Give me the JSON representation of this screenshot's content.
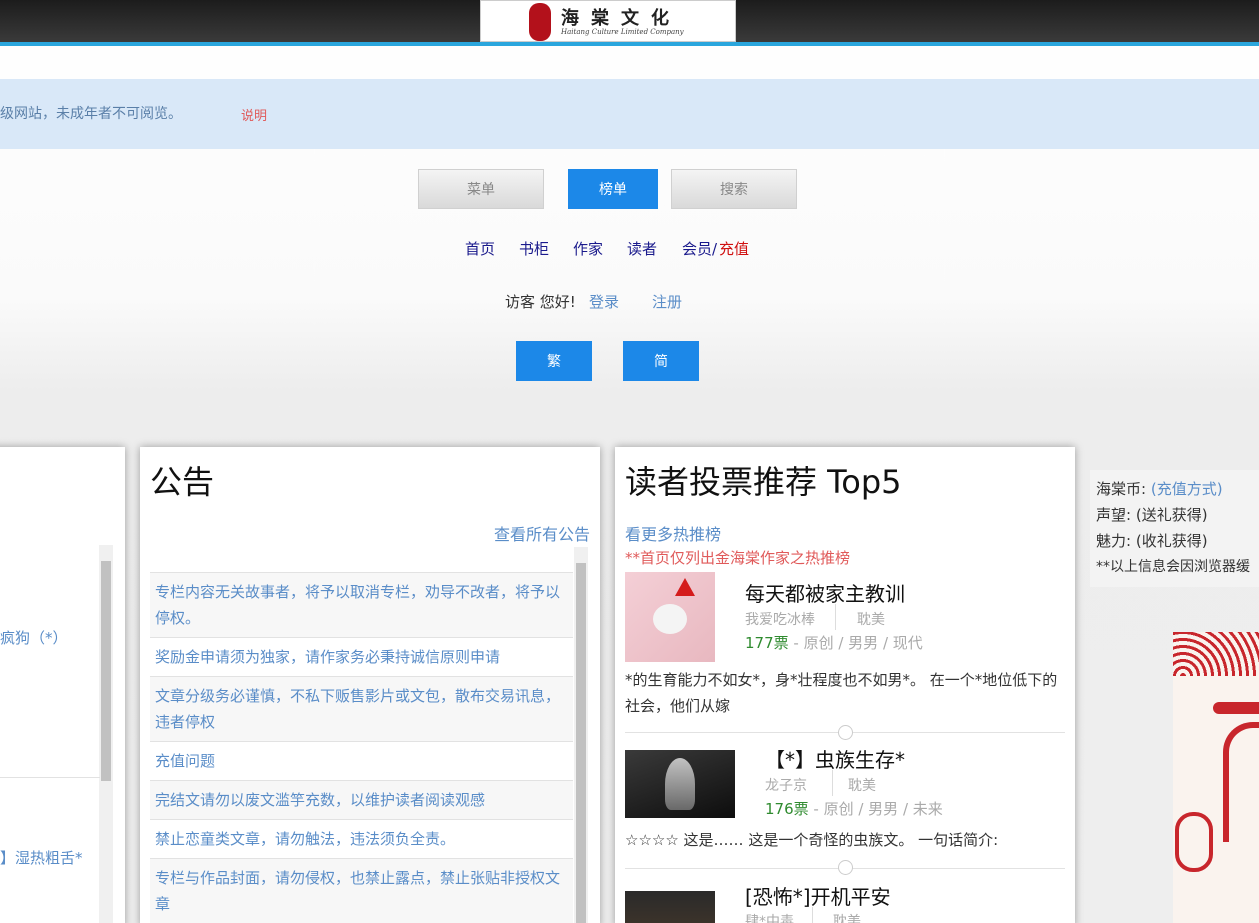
{
  "header": {
    "logo_title": "海棠文化",
    "logo_subtitle": "Haitang Culture Limited Company"
  },
  "notice": {
    "text": "级网站，未成年者不可阅览。",
    "link": "说明"
  },
  "tabs": [
    "菜单",
    "榜单",
    "搜索"
  ],
  "nav": {
    "home": "首页",
    "bookshelf": "书柜",
    "author": "作家",
    "reader": "读者",
    "member": "会员/",
    "recharge": "充值"
  },
  "user": {
    "greeting": "访客 您好!",
    "login": "登录",
    "register": "注册"
  },
  "lang": {
    "traditional": "繁",
    "simplified": "简"
  },
  "left_card": {
    "item1": "疯狗（*）",
    "item2": "】湿热粗舌*"
  },
  "announcements": {
    "title": "公告",
    "view_all": "查看所有公告",
    "items": [
      "专栏内容无关故事者，将予以取消专栏，劝导不改者，将予以停权。",
      "奖励金申请须为独家，请作家务必秉持诚信原则申请",
      "文章分级务必谨慎，不私下贩售影片或文包，散布交易讯息，违者停权",
      "充值问题",
      "完结文请勿以废文滥竽充数，以维护读者阅读观感",
      "禁止恋童类文章，请勿触法，违法须负全责。",
      "专栏与作品封面，请勿侵权，也禁止露点，禁止张贴非授权文章"
    ]
  },
  "ranking": {
    "title": "读者投票推荐 Top5",
    "more": "看更多热推榜",
    "note": "**首页仅列出金海棠作家之热推榜",
    "items": [
      {
        "title": "每天都被家主教训",
        "author": "我爱吃冰棒",
        "category": "耽美",
        "votes": "177票",
        "tags": " - 原创 / 男男 / 现代",
        "desc": "*的生育能力不如女*，身*壮程度也不如男*。 在一个*地位低下的社会，他们从嫁"
      },
      {
        "title": "【*】虫族生存*",
        "author": "龙子京",
        "category": "耽美",
        "votes": "176票",
        "tags": " - 原创 / 男男 / 未来",
        "desc": "☆☆☆☆ 这是…… 这是一个奇怪的虫族文。 一句话简介:"
      },
      {
        "title": "[恐怖*]开机平安",
        "author": "肆*中毒",
        "category": "耽美",
        "votes": "",
        "tags": "",
        "desc": ""
      }
    ]
  },
  "side_info": {
    "coins_label": "海棠币:",
    "coins_value": "(充值方式)",
    "reputation_label": "声望:",
    "reputation_value": "(送礼获得)",
    "charm_label": "魅力:",
    "charm_value": "(收礼获得)",
    "note": "**以上信息会因浏览器缓"
  },
  "colors": {
    "accent_blue": "#1c88e8",
    "top_line": "#2aa6dd",
    "link_blue": "#5a8dc8",
    "alert_red": "#e05a5a",
    "vote_green": "#2f8b2f"
  }
}
